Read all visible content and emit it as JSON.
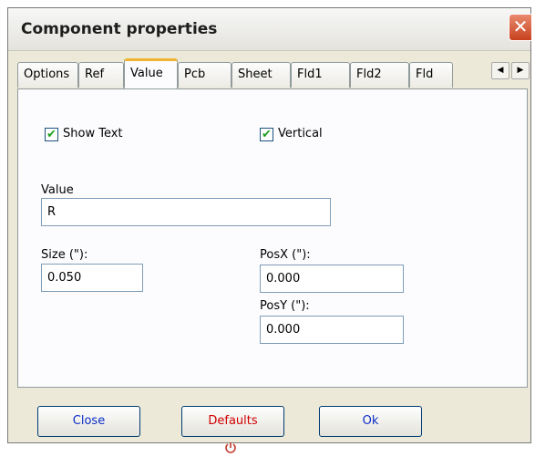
{
  "window": {
    "title": "Component properties",
    "close_glyph": "✕"
  },
  "tabs": [
    {
      "label": "Options"
    },
    {
      "label": "Ref"
    },
    {
      "label": "Value",
      "active": true
    },
    {
      "label": "Pcb"
    },
    {
      "label": "Sheet"
    },
    {
      "label": "Fld1"
    },
    {
      "label": "Fld2"
    },
    {
      "label": "Fld"
    }
  ],
  "tab_scroll": {
    "left": "◀",
    "right": "▶"
  },
  "options": {
    "show_text": {
      "label": "Show Text",
      "checked": true
    },
    "vertical": {
      "label": "Vertical",
      "checked": true
    }
  },
  "fields": {
    "value": {
      "label": "Value",
      "value": "R"
    },
    "size": {
      "label": "Size (\"):",
      "value": "0.050"
    },
    "posx": {
      "label": "PosX (\"):",
      "value": "0.000"
    },
    "posy": {
      "label": "PosY (\"):",
      "value": "0.000"
    }
  },
  "buttons": {
    "close": "Close",
    "defaults": "Defaults",
    "ok": "Ok"
  },
  "colors": {
    "checkmark": "#21a121",
    "active_tab_accent": "#f0b433",
    "defaults_text": "#d10000",
    "button_text": "#0b2dc7"
  }
}
